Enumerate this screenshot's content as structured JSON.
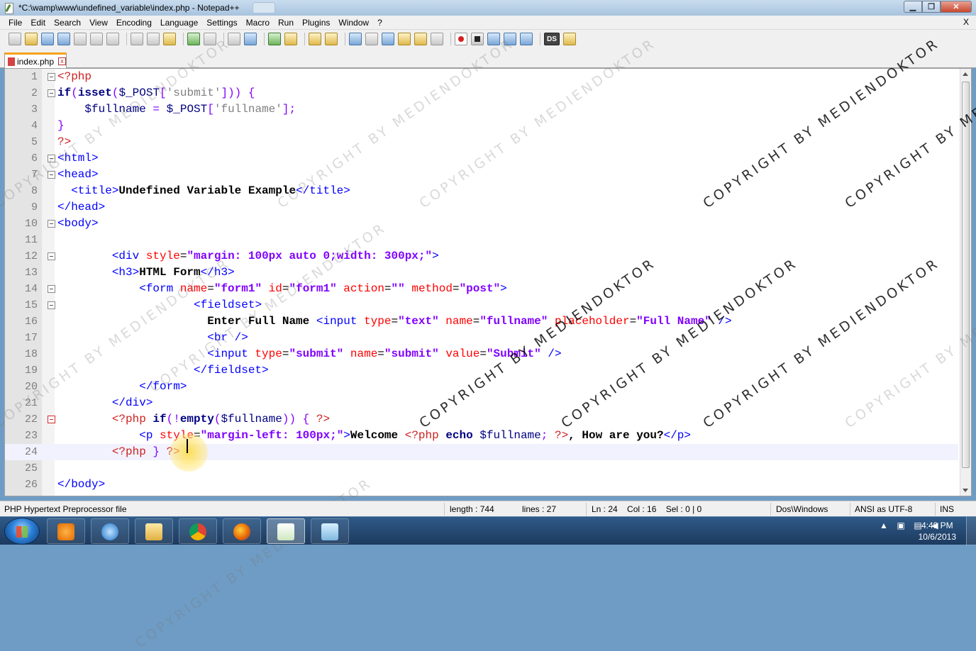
{
  "window": {
    "title": "*C:\\wamp\\www\\undefined_variable\\index.php - Notepad++",
    "minimize_label": "▁",
    "maximize_label": "❐",
    "close_label": "✕"
  },
  "menu": {
    "items": [
      "File",
      "Edit",
      "Search",
      "View",
      "Encoding",
      "Language",
      "Settings",
      "Macro",
      "Run",
      "Plugins",
      "Window",
      "?"
    ],
    "close_label": "X"
  },
  "toolbar": {
    "ds_label": "DS"
  },
  "tab": {
    "label": "index.php",
    "close_label": "x"
  },
  "editor": {
    "current_line": 24,
    "lines": [
      {
        "n": "1",
        "fold": "box"
      },
      {
        "n": "2",
        "fold": "box"
      },
      {
        "n": "3",
        "fold": ""
      },
      {
        "n": "4",
        "fold": ""
      },
      {
        "n": "5",
        "fold": ""
      },
      {
        "n": "6",
        "fold": "box"
      },
      {
        "n": "7",
        "fold": "box"
      },
      {
        "n": "8",
        "fold": ""
      },
      {
        "n": "9",
        "fold": ""
      },
      {
        "n": "10",
        "fold": "box"
      },
      {
        "n": "11",
        "fold": ""
      },
      {
        "n": "12",
        "fold": "box"
      },
      {
        "n": "13",
        "fold": ""
      },
      {
        "n": "14",
        "fold": "box"
      },
      {
        "n": "15",
        "fold": "box"
      },
      {
        "n": "16",
        "fold": ""
      },
      {
        "n": "17",
        "fold": ""
      },
      {
        "n": "18",
        "fold": ""
      },
      {
        "n": "19",
        "fold": ""
      },
      {
        "n": "20",
        "fold": ""
      },
      {
        "n": "21",
        "fold": ""
      },
      {
        "n": "22",
        "fold": "red"
      },
      {
        "n": "23",
        "fold": ""
      },
      {
        "n": "24",
        "fold": ""
      },
      {
        "n": "25",
        "fold": ""
      },
      {
        "n": "26",
        "fold": ""
      }
    ],
    "tokens": [
      [
        [
          "t-php",
          "<?php"
        ]
      ],
      [
        [
          "t-kw",
          "if"
        ],
        [
          "t-op",
          "("
        ],
        [
          "t-fn",
          "isset"
        ],
        [
          "t-op",
          "("
        ],
        [
          "t-var",
          "$_POST"
        ],
        [
          "t-op",
          "["
        ],
        [
          "t-str",
          "'submit'"
        ],
        [
          "t-op",
          "])) {"
        ]
      ],
      [
        [
          "t-plain",
          "    "
        ],
        [
          "t-var",
          "$fullname"
        ],
        [
          "t-op",
          " = "
        ],
        [
          "t-var",
          "$_POST"
        ],
        [
          "t-op",
          "["
        ],
        [
          "t-str",
          "'fullname'"
        ],
        [
          "t-op",
          "];"
        ]
      ],
      [
        [
          "t-op",
          "}"
        ]
      ],
      [
        [
          "t-php",
          "?>"
        ]
      ],
      [
        [
          "t-tag",
          "<html>"
        ]
      ],
      [
        [
          "t-tag",
          "<head>"
        ]
      ],
      [
        [
          "t-plain",
          "  "
        ],
        [
          "t-tag",
          "<title>"
        ],
        [
          "t-text",
          "Undefined Variable Example"
        ],
        [
          "t-tag",
          "</title>"
        ]
      ],
      [
        [
          "t-tag",
          "</head>"
        ]
      ],
      [
        [
          "t-tag",
          "<body>"
        ]
      ],
      [
        [
          "t-plain",
          ""
        ]
      ],
      [
        [
          "t-plain",
          "        "
        ],
        [
          "t-tag",
          "<div "
        ],
        [
          "t-attr",
          "style"
        ],
        [
          "t-plain",
          "="
        ],
        [
          "t-aval",
          "\"margin: 100px auto 0;width: 300px;\""
        ],
        [
          "t-tag",
          ">"
        ]
      ],
      [
        [
          "t-plain",
          "        "
        ],
        [
          "t-tag",
          "<h3>"
        ],
        [
          "t-text",
          "HTML Form"
        ],
        [
          "t-tag",
          "</h3>"
        ]
      ],
      [
        [
          "t-plain",
          "            "
        ],
        [
          "t-tag",
          "<form "
        ],
        [
          "t-attr",
          "name"
        ],
        [
          "t-plain",
          "="
        ],
        [
          "t-aval",
          "\"form1\""
        ],
        [
          "t-attr",
          " id"
        ],
        [
          "t-plain",
          "="
        ],
        [
          "t-aval",
          "\"form1\""
        ],
        [
          "t-attr",
          " action"
        ],
        [
          "t-plain",
          "="
        ],
        [
          "t-aval",
          "\"\""
        ],
        [
          "t-attr",
          " method"
        ],
        [
          "t-plain",
          "="
        ],
        [
          "t-aval",
          "\"post\""
        ],
        [
          "t-tag",
          ">"
        ]
      ],
      [
        [
          "t-plain",
          "                    "
        ],
        [
          "t-tag",
          "<fieldset>"
        ]
      ],
      [
        [
          "t-plain",
          "                      "
        ],
        [
          "t-text",
          "Enter Full Name "
        ],
        [
          "t-tag",
          "<input "
        ],
        [
          "t-attr",
          "type"
        ],
        [
          "t-plain",
          "="
        ],
        [
          "t-aval",
          "\"text\""
        ],
        [
          "t-attr",
          " name"
        ],
        [
          "t-plain",
          "="
        ],
        [
          "t-aval",
          "\"fullname\""
        ],
        [
          "t-attr",
          " placeholder"
        ],
        [
          "t-plain",
          "="
        ],
        [
          "t-aval",
          "\"Full Name\""
        ],
        [
          "t-tag",
          " />"
        ]
      ],
      [
        [
          "t-plain",
          "                      "
        ],
        [
          "t-tag",
          "<br />"
        ]
      ],
      [
        [
          "t-plain",
          "                      "
        ],
        [
          "t-tag",
          "<input "
        ],
        [
          "t-attr",
          "type"
        ],
        [
          "t-plain",
          "="
        ],
        [
          "t-aval",
          "\"submit\""
        ],
        [
          "t-attr",
          " name"
        ],
        [
          "t-plain",
          "="
        ],
        [
          "t-aval",
          "\"submit\""
        ],
        [
          "t-attr",
          " value"
        ],
        [
          "t-plain",
          "="
        ],
        [
          "t-aval",
          "\"Submit\""
        ],
        [
          "t-tag",
          " />"
        ]
      ],
      [
        [
          "t-plain",
          "                    "
        ],
        [
          "t-tag",
          "</fieldset>"
        ]
      ],
      [
        [
          "t-plain",
          "            "
        ],
        [
          "t-tag",
          "</form>"
        ]
      ],
      [
        [
          "t-plain",
          "        "
        ],
        [
          "t-tag",
          "</div>"
        ]
      ],
      [
        [
          "t-plain",
          "        "
        ],
        [
          "t-php",
          "<?php "
        ],
        [
          "t-kw",
          "if"
        ],
        [
          "t-op",
          "(!"
        ],
        [
          "t-fn",
          "empty"
        ],
        [
          "t-op",
          "("
        ],
        [
          "t-var",
          "$fullname"
        ],
        [
          "t-op",
          ")) { "
        ],
        [
          "t-php",
          "?>"
        ]
      ],
      [
        [
          "t-plain",
          "            "
        ],
        [
          "t-tag",
          "<p "
        ],
        [
          "t-attr",
          "style"
        ],
        [
          "t-plain",
          "="
        ],
        [
          "t-aval",
          "\"margin-left: 100px;\""
        ],
        [
          "t-tag",
          ">"
        ],
        [
          "t-text",
          "Welcome "
        ],
        [
          "t-php",
          "<?php "
        ],
        [
          "t-kw",
          "echo "
        ],
        [
          "t-var",
          "$fullname"
        ],
        [
          "t-op",
          "; "
        ],
        [
          "t-php",
          "?>"
        ],
        [
          "t-text",
          ", How are you?"
        ],
        [
          "t-tag",
          "</p>"
        ]
      ],
      [
        [
          "t-plain",
          "        "
        ],
        [
          "t-php",
          "<?php "
        ],
        [
          "t-op",
          "} "
        ],
        [
          "t-php",
          "?>"
        ]
      ],
      [
        [
          "t-plain",
          ""
        ]
      ],
      [
        [
          "t-tag",
          "</body>"
        ]
      ]
    ]
  },
  "watermark": {
    "text": "COPYRIGHT BY MEDIENDOKTOR"
  },
  "status": {
    "file_type": "PHP Hypertext Preprocessor file",
    "length": "length : 744",
    "lines": "lines : 27",
    "position": "Ln : 24    Col : 16    Sel : 0 | 0",
    "eol": "Dos\\Windows",
    "encoding": "ANSI as UTF-8",
    "mode": "INS"
  },
  "taskbar": {
    "time": "4:49 PM",
    "date": "10/6/2013",
    "apps": [
      "media-player",
      "internet-explorer",
      "file-explorer",
      "chrome",
      "firefox",
      "notepad-plus-plus",
      "notepad"
    ]
  }
}
